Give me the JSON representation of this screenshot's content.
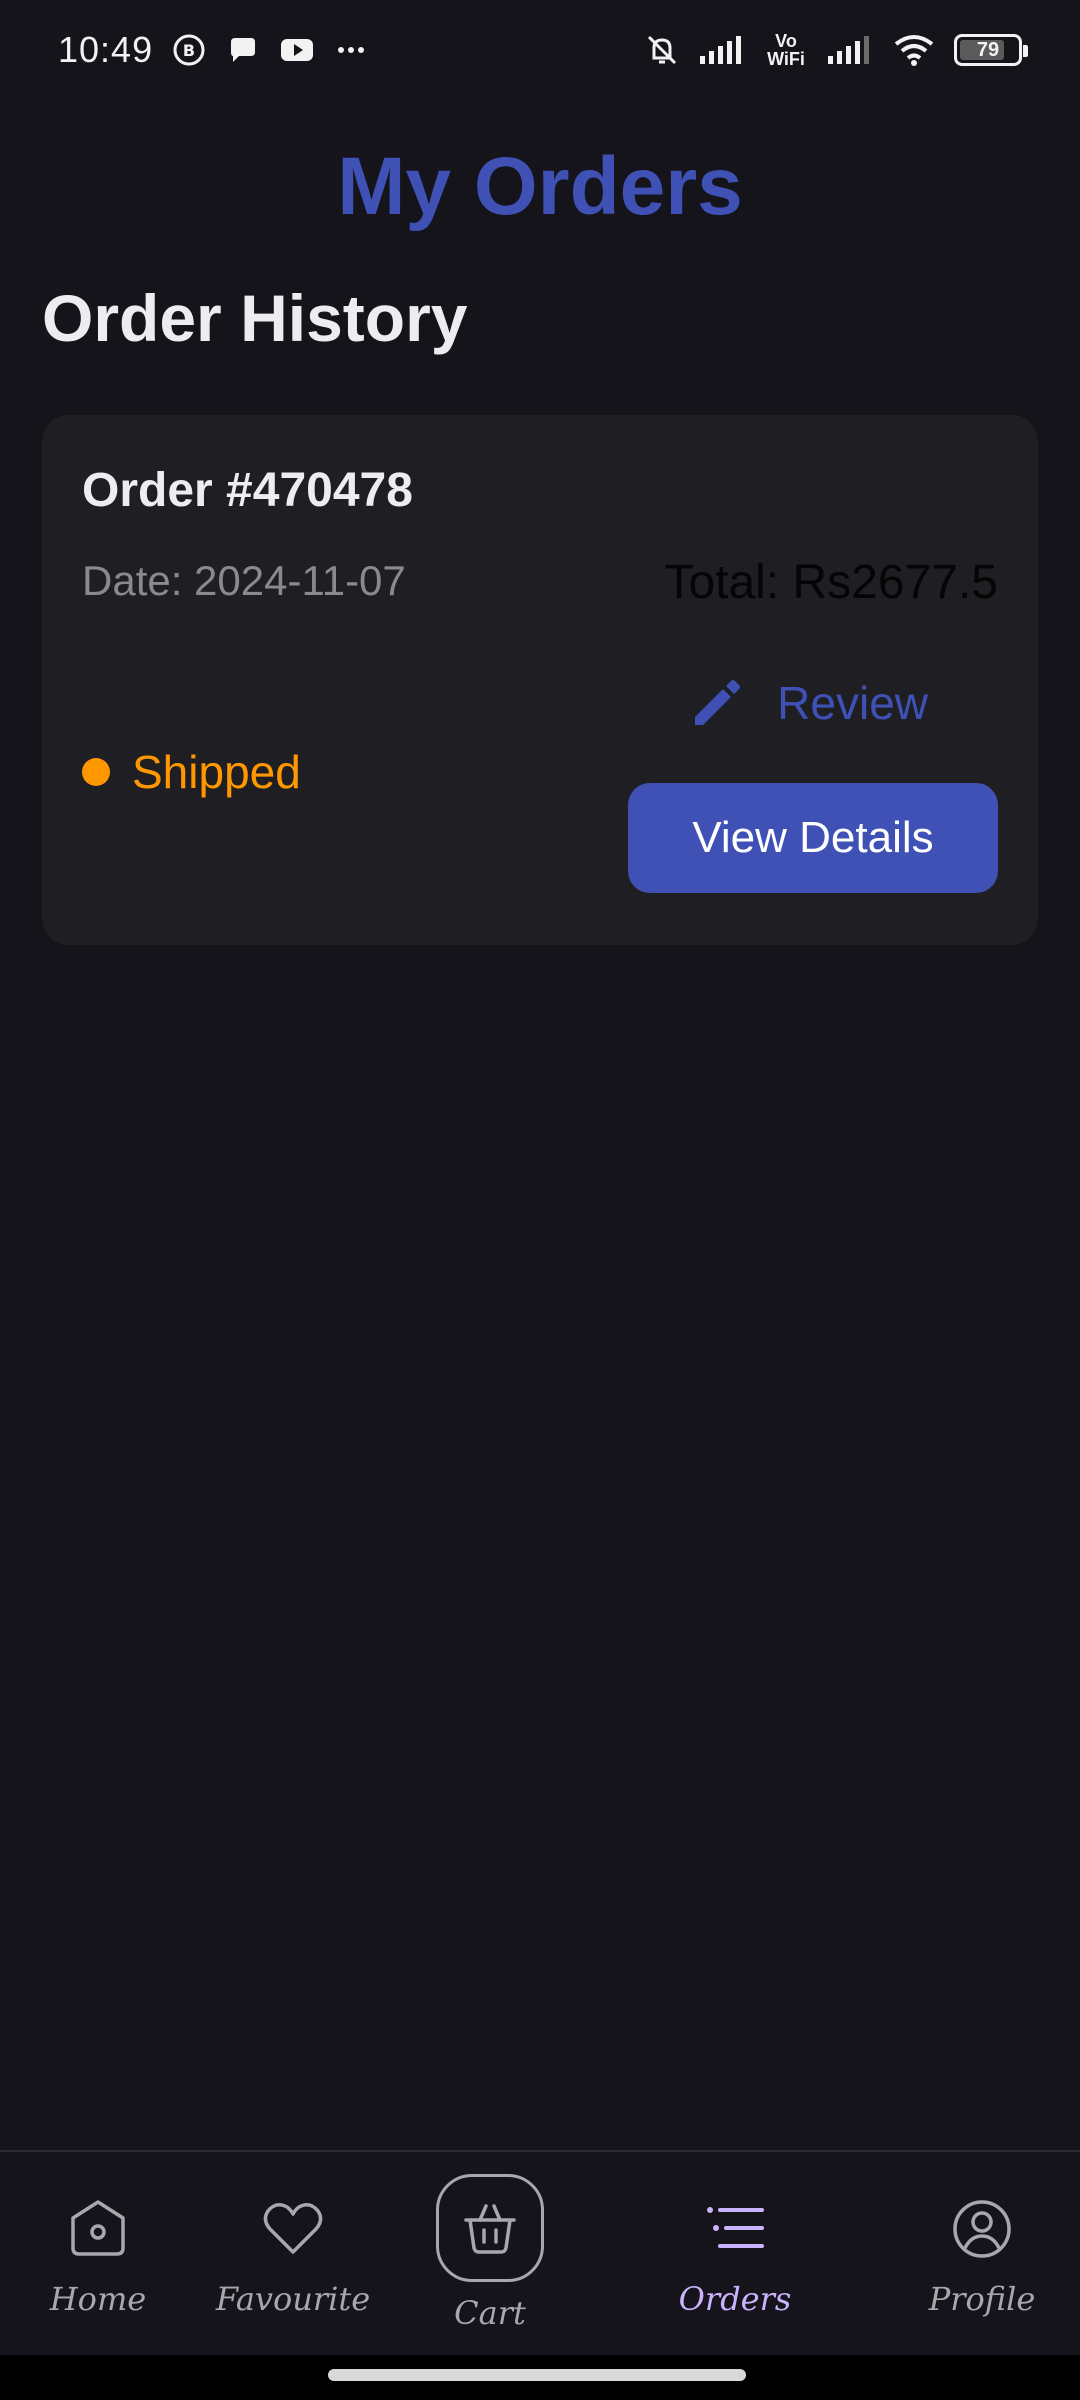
{
  "status_bar": {
    "time": "10:49",
    "vowifi": "Vo\nWiFi",
    "battery_level": "79",
    "battery_fraction": 0.79
  },
  "page": {
    "title": "My Orders",
    "section_title": "Order History"
  },
  "orders": [
    {
      "number": "Order #470478",
      "date": "Date: 2024-11-07",
      "total": "Total: Rs2677.5",
      "review_label": "Review",
      "status": "Shipped",
      "status_color": "#ff9800",
      "view_details_label": "View Details"
    }
  ],
  "bottom_nav": {
    "items": [
      {
        "label": "Home",
        "icon": "home-icon"
      },
      {
        "label": "Favourite",
        "icon": "heart-icon"
      },
      {
        "label": "Cart",
        "icon": "basket-icon"
      },
      {
        "label": "Orders",
        "icon": "list-icon",
        "active": true
      },
      {
        "label": "Profile",
        "icon": "user-icon"
      }
    ]
  },
  "colors": {
    "background": "#16141b",
    "card": "#1f1e23",
    "accent": "#3f51b5",
    "status_shipped": "#ff9800",
    "active_nav": "#c9b3ff"
  }
}
